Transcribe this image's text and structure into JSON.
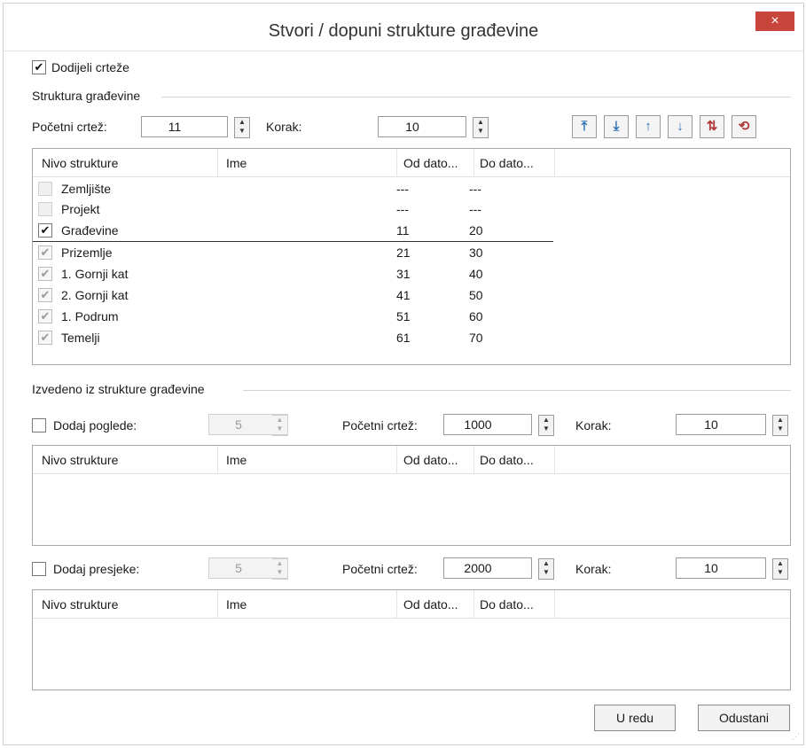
{
  "window": {
    "title": "Stvori / dopuni strukture građevine",
    "close_label": "×"
  },
  "assign": {
    "label": "Dodijeli crteže",
    "checked": "✔"
  },
  "structure": {
    "group_label": "Struktura građevine",
    "start_label": "Početni crtež:",
    "start_value": "11",
    "step_label": "Korak:",
    "step_value": "10",
    "tool_icons": [
      "move-to-top-icon",
      "move-to-bottom-icon",
      "move-up-icon",
      "move-down-icon",
      "renumber-icon",
      "reset-structure-icon"
    ],
    "columns": [
      "Nivo strukture",
      "Ime",
      "Od dato...",
      "Do dato..."
    ],
    "rows": [
      {
        "name": "Zemljište",
        "from": "---",
        "to": "---",
        "check": ""
      },
      {
        "name": "Projekt",
        "from": "---",
        "to": "---",
        "check": ""
      },
      {
        "name": "Građevine",
        "from": "11",
        "to": "20",
        "check": "✔"
      },
      {
        "name": "Prizemlje",
        "from": "21",
        "to": "30",
        "check": "✔"
      },
      {
        "name": "1. Gornji kat",
        "from": "31",
        "to": "40",
        "check": "✔"
      },
      {
        "name": "2. Gornji kat",
        "from": "41",
        "to": "50",
        "check": "✔"
      },
      {
        "name": "1. Podrum",
        "from": "51",
        "to": "60",
        "check": "✔"
      },
      {
        "name": "Temelji",
        "from": "61",
        "to": "70",
        "check": "✔"
      }
    ]
  },
  "derived": {
    "group_label": "Izvedeno iz strukture građevine",
    "views": {
      "label": "Dodaj poglede:",
      "count": "5",
      "start_label": "Početni crtež:",
      "start_value": "1000",
      "step_label": "Korak:",
      "step_value": "10",
      "columns": [
        "Nivo strukture",
        "Ime",
        "Od dato...",
        "Do dato..."
      ]
    },
    "sections": {
      "label": "Dodaj presjeke:",
      "count": "5",
      "start_label": "Početni crtež:",
      "start_value": "2000",
      "step_label": "Korak:",
      "step_value": "10",
      "columns": [
        "Nivo strukture",
        "Ime",
        "Od dato...",
        "Do dato..."
      ]
    }
  },
  "footer": {
    "ok_label": "U redu",
    "cancel_label": "Odustani"
  }
}
